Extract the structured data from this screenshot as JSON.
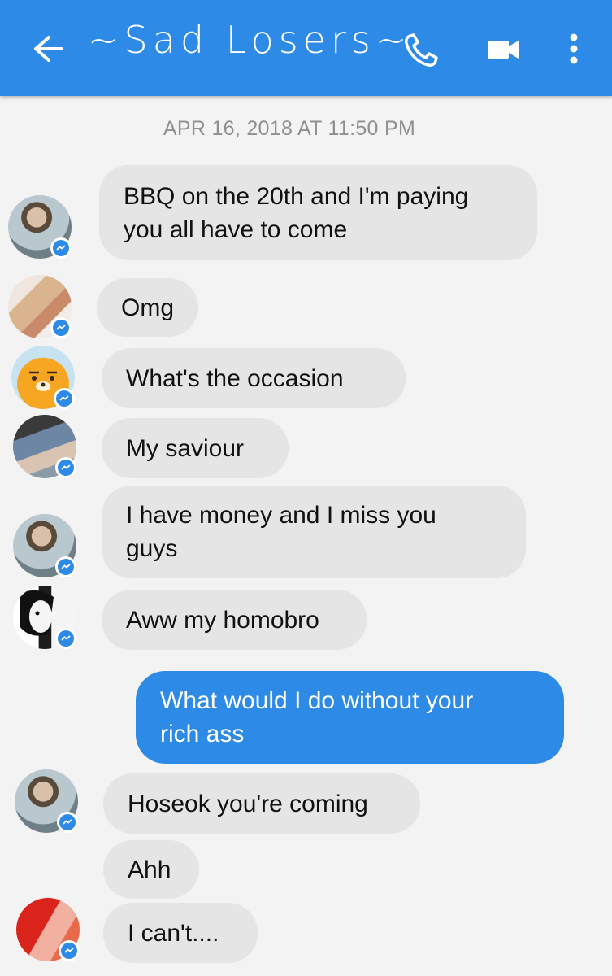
{
  "header": {
    "title": "~Sad Losers~",
    "back_icon": "arrow-left-icon",
    "call_icon": "phone-icon",
    "video_icon": "video-camera-icon",
    "more_icon": "more-vertical-icon",
    "color": "#2d8ae6"
  },
  "conversation": {
    "timestamp": "APR 16, 2018 AT 11:50 PM",
    "messages": [
      {
        "text": "BBQ on the 20th and I'm paying\nyou all have to come",
        "sender": "other"
      },
      {
        "text": "Omg",
        "sender": "other"
      },
      {
        "text": "What's the occasion",
        "sender": "other"
      },
      {
        "text": "My saviour",
        "sender": "other"
      },
      {
        "text": "I have money and I miss you\nguys",
        "sender": "other"
      },
      {
        "text": "Aww my homobro",
        "sender": "other"
      },
      {
        "text": "What would I do without your\nrich ass",
        "sender": "me"
      },
      {
        "text": "Hoseok you're coming",
        "sender": "other"
      },
      {
        "text": "Ahh",
        "sender": "other"
      },
      {
        "text": "I can't....",
        "sender": "other"
      }
    ]
  },
  "colors": {
    "accent": "#2d8ae6",
    "incoming_bubble": "#e5e5e5",
    "background": "#f3f3f3",
    "timestamp_text": "#8f8f8f"
  }
}
